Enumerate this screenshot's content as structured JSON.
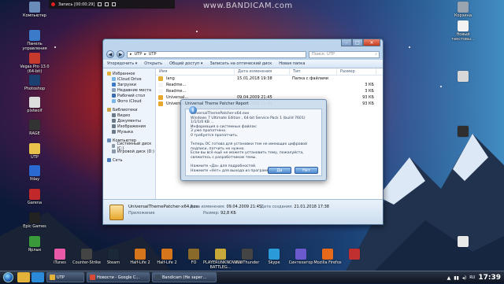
{
  "recorder": {
    "label": "Запись [00:00:29]"
  },
  "watermark": "www.BANDICAM.com",
  "desktop_icons_left": [
    {
      "label": "Компьютер",
      "color": "#6a8cb8"
    },
    {
      "label": "Панель управления",
      "color": "#3a7ac8"
    },
    {
      "label": "Vegas Pro 13.0 (64-bit)",
      "color": "#c63a2e"
    },
    {
      "label": "Photoshop",
      "color": "#1b3f6e"
    },
    {
      "label": "pixlwolf",
      "color": "#ddd"
    },
    {
      "label": "RAGE",
      "color": "#333"
    },
    {
      "label": "UTP",
      "color": "#e8c24a"
    },
    {
      "label": "Уdaу",
      "color": "#2a6ad0"
    },
    {
      "label": "Garena",
      "color": "#c0282a"
    },
    {
      "label": "Epic Games",
      "color": "#222"
    },
    {
      "label": "Ярлык",
      "color": "#3a9a3a"
    }
  ],
  "desktop_icons_right": [
    {
      "label": "Корзина",
      "color": "#9aa4b0"
    },
    {
      "label": "Новый текстовы...",
      "color": "#f2f2f2"
    },
    {
      "label": "",
      "color": "#d8d8d8"
    },
    {
      "label": "",
      "color": "#2f2f2f"
    },
    {
      "label": "",
      "color": "#e8e8e8"
    }
  ],
  "desktop_icons_bottom": [
    {
      "label": "iTunes",
      "color": "#e85aa8"
    },
    {
      "label": "Counter-Strike",
      "color": "#444"
    },
    {
      "label": "Steam",
      "color": "#1b2838"
    },
    {
      "label": "Half-Life 2",
      "color": "#d6761c"
    },
    {
      "label": "Half-Life 2",
      "color": "#d6761c"
    },
    {
      "label": "FO",
      "color": "#8a6a2a"
    },
    {
      "label": "PLAYERUNKNOWN'S BATTLEG...",
      "color": "#c7a83a"
    },
    {
      "label": "WarThunder",
      "color": "#444"
    },
    {
      "label": "Skype",
      "color": "#2a9ad8"
    },
    {
      "label": "Синтезатор",
      "color": "#6a5acd"
    },
    {
      "label": "Mozilla Firefox",
      "color": "#e66a1a"
    },
    {
      "label": "",
      "color": "#c03030"
    }
  ],
  "explorer": {
    "address": [
      "UTP",
      "UTP"
    ],
    "search_placeholder": "Поиск: UTP",
    "toolbar": [
      "Упорядочить ▾",
      "Открыть",
      "Общий доступ ▾",
      "Записать на оптический диск",
      "Новая папка"
    ],
    "nav": [
      {
        "label": "Избранное",
        "sub": false,
        "color": "#e3b23a"
      },
      {
        "label": "iCloud Drive",
        "sub": true,
        "color": "#7bb6e8"
      },
      {
        "label": "Загрузки",
        "sub": true,
        "color": "#3a7ac8"
      },
      {
        "label": "Недавние места",
        "sub": true,
        "color": "#8aa0b8"
      },
      {
        "label": "Рабочий стол",
        "sub": true,
        "color": "#3a6ab0"
      },
      {
        "label": "Фото iCloud",
        "sub": true,
        "color": "#7bb6e8"
      },
      {
        "label": "",
        "sub": false,
        "color": ""
      },
      {
        "label": "Библиотеки",
        "sub": false,
        "color": "#c9a545"
      },
      {
        "label": "Видео",
        "sub": true,
        "color": "#6a7a8a"
      },
      {
        "label": "Документы",
        "sub": true,
        "color": "#6a7a8a"
      },
      {
        "label": "Изображения",
        "sub": true,
        "color": "#6a7a8a"
      },
      {
        "label": "Музыка",
        "sub": true,
        "color": "#6a7a8a"
      },
      {
        "label": "",
        "sub": false,
        "color": ""
      },
      {
        "label": "Компьютер",
        "sub": false,
        "color": "#6a8cb8"
      },
      {
        "label": "Системный диск (C:)",
        "sub": true,
        "color": "#8a9aaa"
      },
      {
        "label": "Игровой диск (D:)",
        "sub": true,
        "color": "#8a9aaa"
      },
      {
        "label": "",
        "sub": false,
        "color": ""
      },
      {
        "label": "Сеть",
        "sub": false,
        "color": "#4a7ab8"
      }
    ],
    "columns": [
      "Имя",
      "Дата изменения",
      "Тип",
      "Размер"
    ],
    "files": [
      {
        "name": "lang",
        "date": "15.01.2018 19:38",
        "type": "Папка с файлами",
        "size": "",
        "color": "#e3b23a"
      },
      {
        "name": "Readme...",
        "date": "",
        "type": "",
        "size": "3 КБ",
        "color": "#f4f4f4"
      },
      {
        "name": "Readme...",
        "date": "",
        "type": "",
        "size": "3 КБ",
        "color": "#f4f4f4"
      },
      {
        "name": "Universal...",
        "date": "09.04.2009 21:45",
        "type": "",
        "size": "93 КБ",
        "color": "#e7a72c"
      },
      {
        "name": "Universal...",
        "date": "09.04.2009 21:45",
        "type": "",
        "size": "93 КБ",
        "color": "#e7a72c"
      }
    ],
    "details": {
      "name": "UniversalThemePatcher-x64.exe",
      "modified_label": "Дата изменения:",
      "modified": "09.04.2009 21:45",
      "created_label": "Дата создания:",
      "created": "21.01.2018 17:38",
      "type": "Приложение",
      "size_label": "Размер:",
      "size": "92,8 КБ"
    }
  },
  "dialog": {
    "title": "Universal Theme Patcher Report",
    "lines": [
      "UniversalThemePatcher-x64.exe",
      "Windows 7 Ultimate Edition , 64-bit Service Pack 1 (build 7601)",
      "1/1/1/0 KB ...",
      "Информация о системных файлах:",
      "3 уже пропатчено.",
      "0 требуется пропатчить.",
      "",
      "Теперь ОС готова для установки тем не имеющих цифровой",
      "подписи, патчить не нужно.",
      "Если вы всё ещё не можете установить тему, пожалуйста,",
      "свяжитесь с разработчиком темы.",
      "",
      "Нажмите «Да» для подробностей.",
      "Нажмите «Нет» для выхода из программы."
    ],
    "yes": "Да",
    "no": "Нет"
  },
  "taskbar": {
    "tasks": [
      {
        "label": "UTP",
        "color": "#e3b23a"
      },
      {
        "label": "Новости - Google C...",
        "color": "#d84a38"
      },
      {
        "label": "Bandicam (Не зарег...",
        "color": "#3a4a5a"
      }
    ],
    "lang": "RU",
    "clock": "17:39"
  }
}
